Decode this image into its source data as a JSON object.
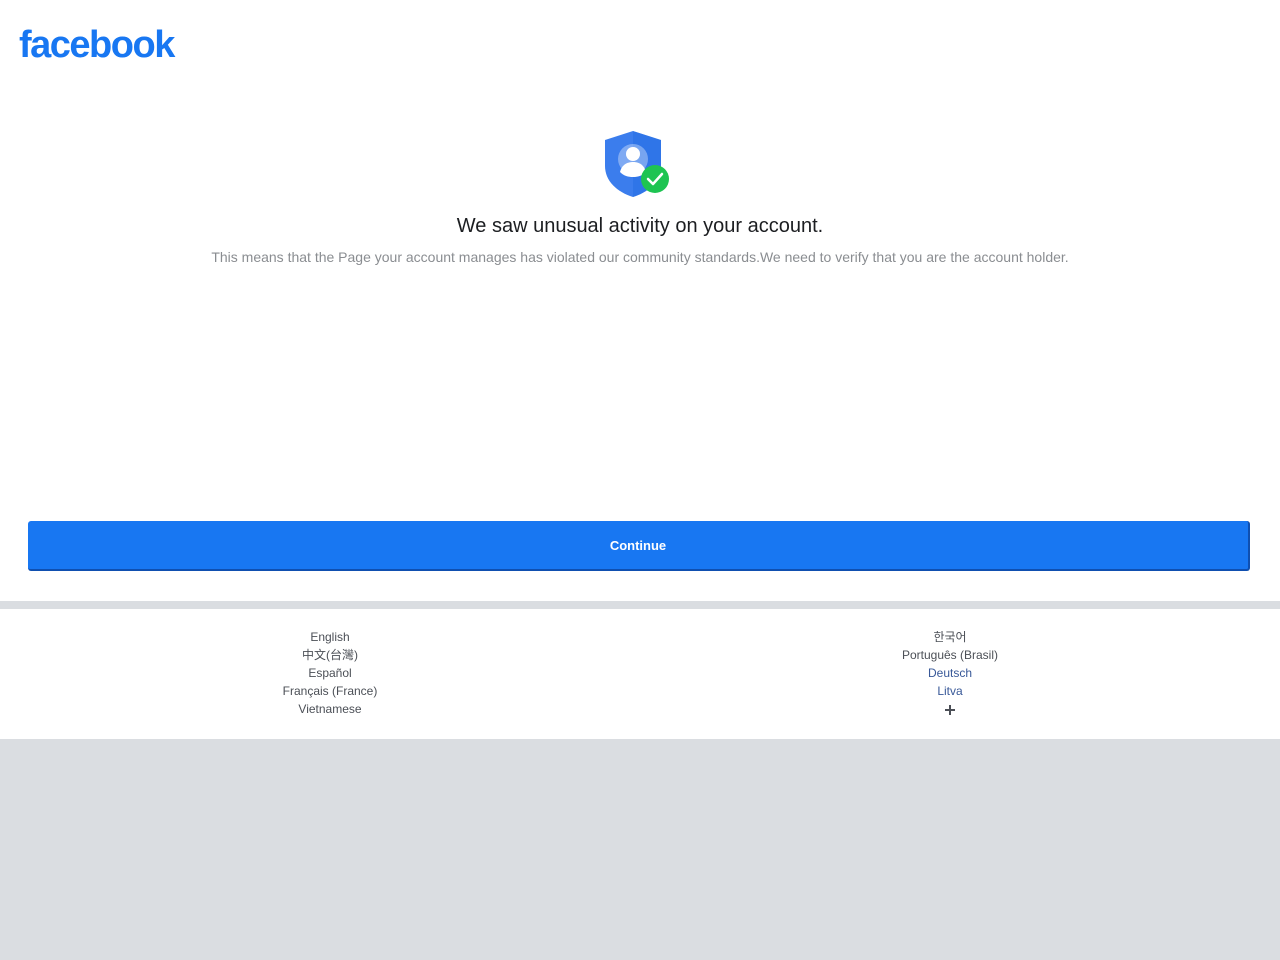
{
  "brand": {
    "logo_text": "facebook",
    "color": "#1877f2"
  },
  "main": {
    "icon": "shield-person-check-icon",
    "headline": "We saw unusual activity on your account.",
    "subtext": "This means that the Page your account manages has violated our community standards.We need to verify that you are the account holder.",
    "continue_label": "Continue"
  },
  "footer": {
    "left_languages": [
      {
        "label": "English"
      },
      {
        "label": "中文(台灣)"
      },
      {
        "label": "Español"
      },
      {
        "label": "Français (France)"
      },
      {
        "label": "Vietnamese"
      }
    ],
    "right_languages": [
      {
        "label": "한국어"
      },
      {
        "label": "Português (Brasil)"
      },
      {
        "label": "Deutsch"
      },
      {
        "label": "Litva"
      }
    ],
    "more_icon": "plus-icon"
  }
}
